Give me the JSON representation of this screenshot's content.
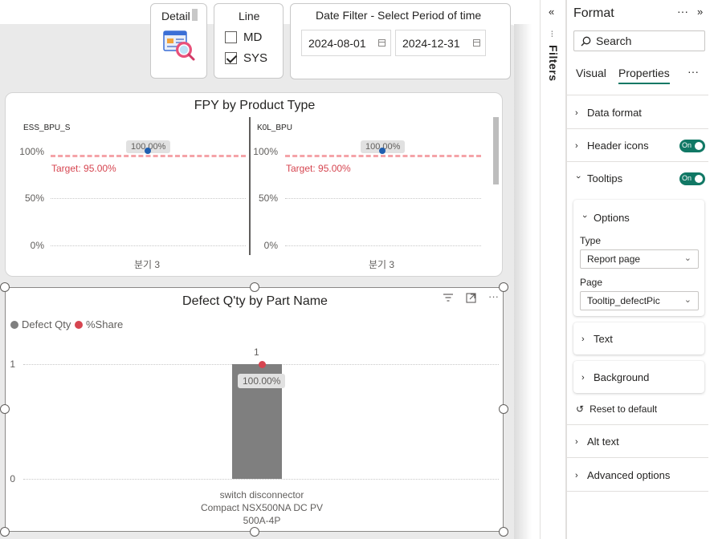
{
  "slicers": {
    "detail": {
      "title": "Detail",
      "icon": "report-magnifier-icon"
    },
    "line": {
      "title": "Line",
      "options": [
        {
          "label": "MD",
          "checked": false
        },
        {
          "label": "SYS",
          "checked": true
        }
      ]
    },
    "date_filter": {
      "title": "Date Filter - Select Period of time",
      "start": "2024-08-01",
      "end": "2024-12-31"
    }
  },
  "fpy_chart": {
    "title": "FPY by Product Type",
    "facets": [
      {
        "label": "ESS_BPU_S",
        "category": "분기 3",
        "value_label": "100.00%",
        "target_label": "Target: 95.00%"
      },
      {
        "label": "K0L_BPU",
        "category": "분기 3",
        "value_label": "100.00%",
        "target_label": "Target: 95.00%"
      }
    ],
    "yticks": [
      "100%",
      "50%",
      "0%"
    ]
  },
  "defect_chart": {
    "title": "Defect Q'ty by Part Name",
    "legend": [
      {
        "name": "Defect Qty",
        "color": "#7f7f7f"
      },
      {
        "name": "%Share",
        "color": "#d64550"
      }
    ],
    "yticks": [
      "1",
      "0"
    ],
    "bar_value_label": "1",
    "share_label": "100.00%",
    "category_lines": [
      "switch disconnector",
      "Compact NSX500NA DC PV",
      "500A-4P"
    ],
    "header_icons": [
      "filter-icon",
      "focus-mode-icon",
      "more-options-icon"
    ]
  },
  "chart_data": [
    {
      "type": "scatter",
      "title": "FPY by Product Type",
      "categories": [
        "분기 3"
      ],
      "series": [
        {
          "name": "ESS_BPU_S",
          "values": [
            100
          ]
        },
        {
          "name": "K0L_BPU",
          "values": [
            100
          ]
        }
      ],
      "target": 95,
      "ylim": [
        0,
        100
      ]
    },
    {
      "type": "bar",
      "title": "Defect Q'ty by Part Name",
      "categories": [
        "switch disconnector Compact NSX500NA DC PV 500A-4P"
      ],
      "series": [
        {
          "name": "Defect Qty",
          "values": [
            1
          ]
        },
        {
          "name": "%Share",
          "values": [
            100
          ]
        }
      ],
      "ylim": [
        0,
        1
      ]
    }
  ],
  "filters_pane": {
    "label": "Filters"
  },
  "format_pane": {
    "title": "Format",
    "search_placeholder": "Search",
    "tabs": [
      "Visual",
      "Properties"
    ],
    "sections": {
      "data_format": "Data format",
      "header_icons": "Header icons",
      "tooltips": "Tooltips",
      "options": "Options",
      "type_label": "Type",
      "type_value": "Report page",
      "page_label": "Page",
      "page_value": "Tooltip_defectPic",
      "text": "Text",
      "background": "Background",
      "reset": "Reset to default",
      "alt_text": "Alt text",
      "advanced": "Advanced options"
    },
    "toggle_on": "On",
    "accent": "#117865"
  }
}
